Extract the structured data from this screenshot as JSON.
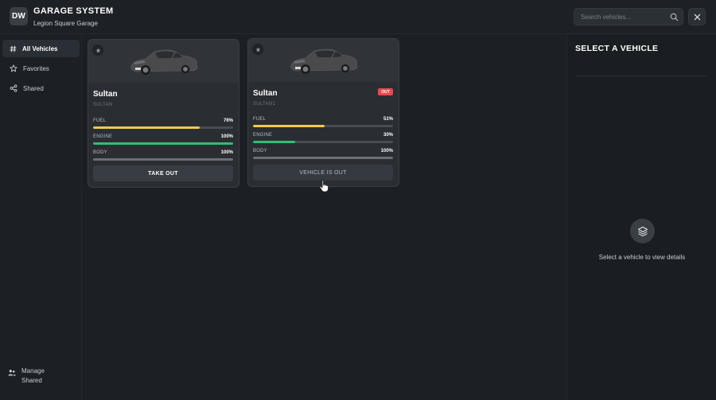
{
  "header": {
    "logo": "DW",
    "title": "GARAGE SYSTEM",
    "subtitle": "Legion Square Garage",
    "search_placeholder": "Search vehicles..."
  },
  "sidebar": {
    "items": [
      {
        "label": "All Vehicles",
        "icon": "hash-icon",
        "active": true
      },
      {
        "label": "Favorites",
        "icon": "star-icon",
        "active": false
      },
      {
        "label": "Shared",
        "icon": "share-icon",
        "active": false
      }
    ],
    "manage_label": "Manage Shared"
  },
  "vehicles": [
    {
      "name": "Sultan",
      "model": "SULTAN",
      "status_badge": "",
      "stats": [
        {
          "label": "FUEL",
          "value": "76%",
          "level": 76,
          "color": "#f2c94c"
        },
        {
          "label": "ENGINE",
          "value": "100%",
          "level": 100,
          "color": "#2fbf71"
        },
        {
          "label": "BODY",
          "value": "100%",
          "level": 100,
          "color": "#6b7077"
        }
      ],
      "action_label": "TAKE OUT"
    },
    {
      "name": "Sultan",
      "model": "SULTAN1",
      "status_badge": "OUT",
      "stats": [
        {
          "label": "FUEL",
          "value": "51%",
          "level": 51,
          "color": "#f2c94c"
        },
        {
          "label": "ENGINE",
          "value": "30%",
          "level": 30,
          "color": "#2fbf71"
        },
        {
          "label": "BODY",
          "value": "100%",
          "level": 100,
          "color": "#6b7077"
        }
      ],
      "action_label": "VEHICLE IS OUT"
    }
  ],
  "detail": {
    "title": "SELECT A VEHICLE",
    "empty_text": "Select a vehicle to view details",
    "empty_icon": "layers-icon"
  },
  "colors": {
    "accent_fuel": "#f2c94c",
    "accent_engine": "#2fbf71",
    "badge_out": "#e5484d"
  }
}
